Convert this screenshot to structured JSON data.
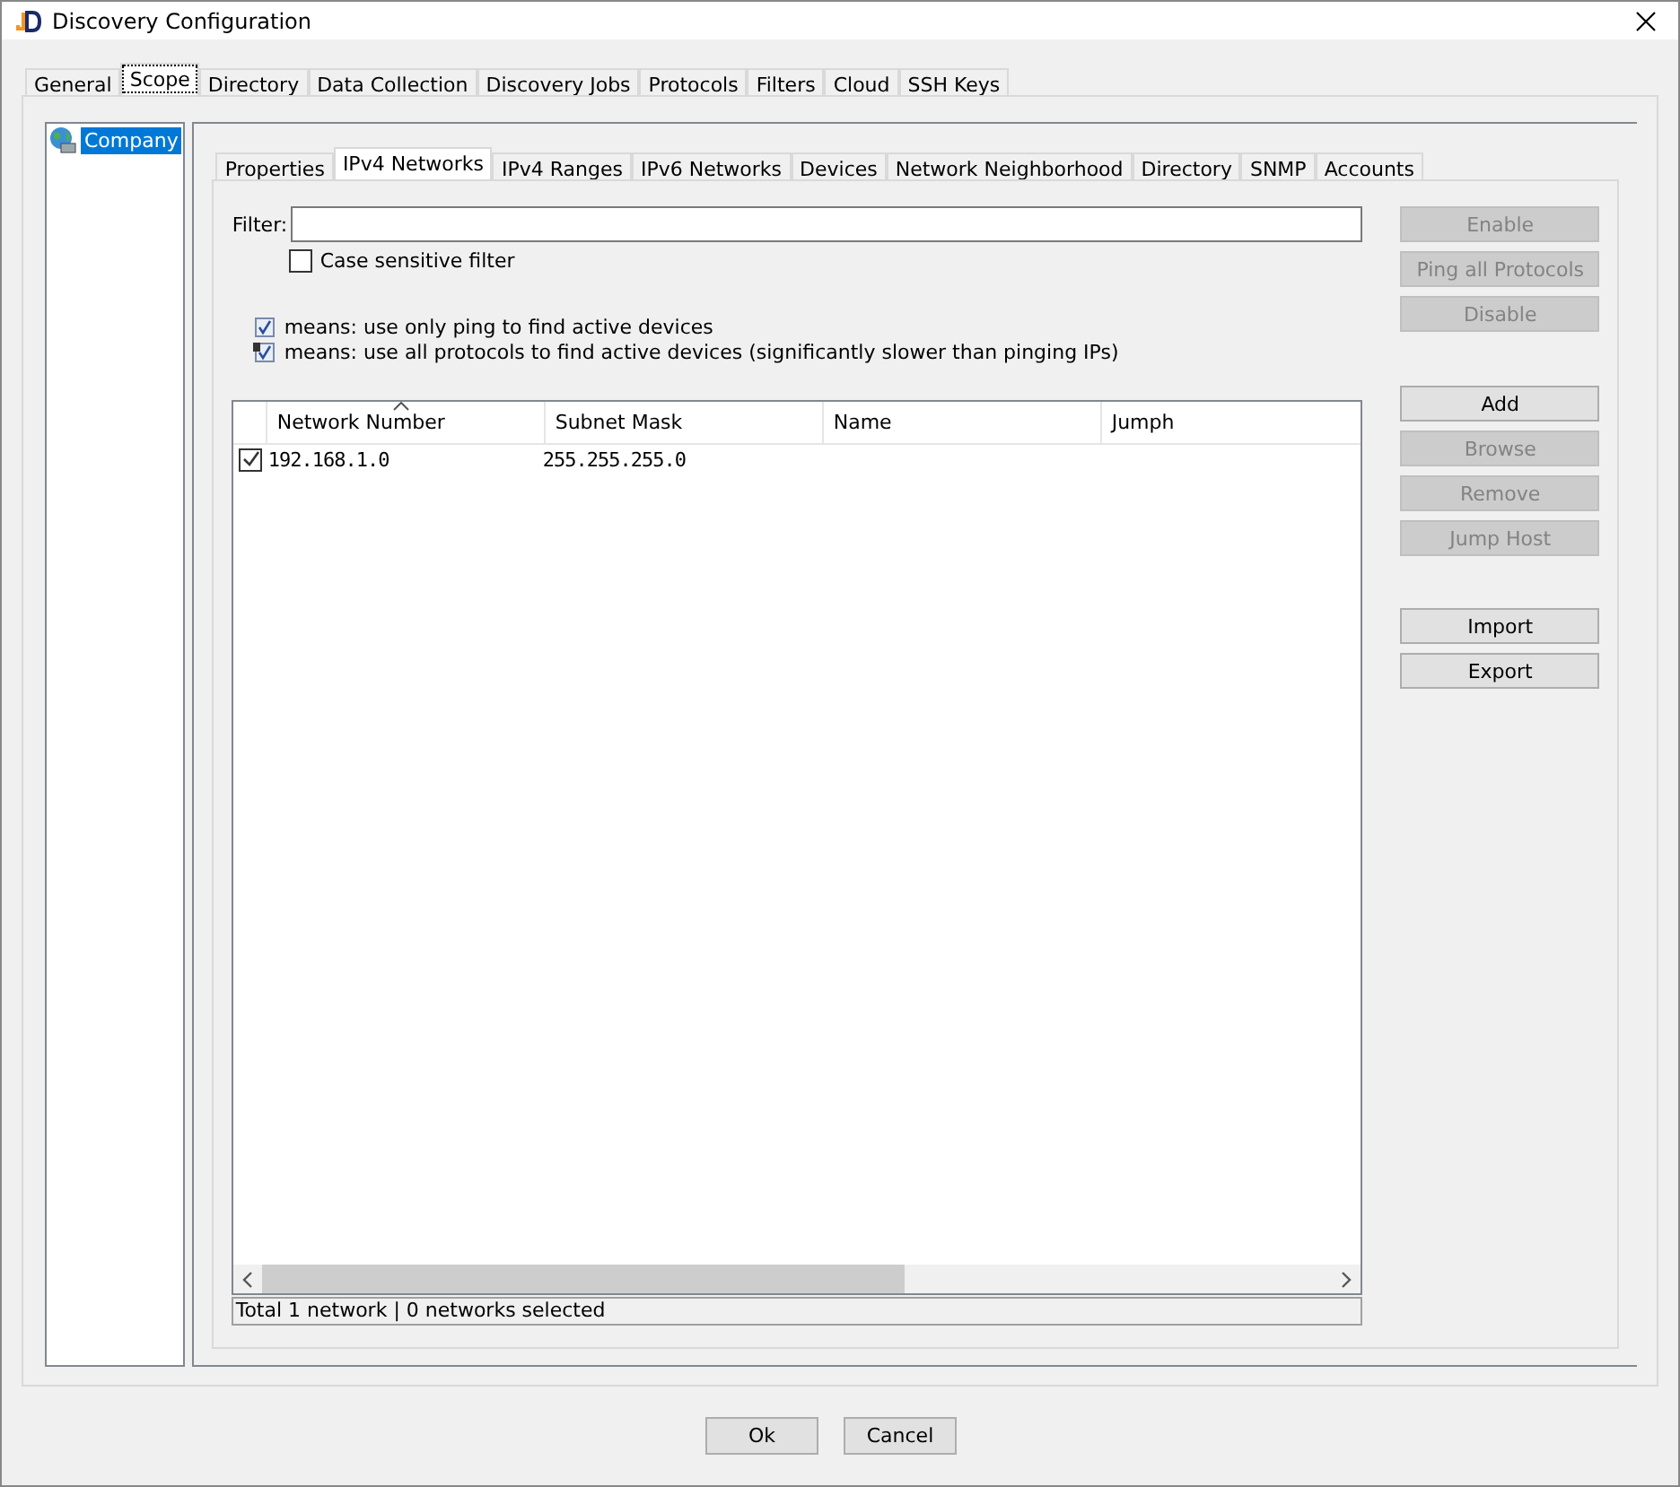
{
  "window": {
    "title": "Discovery Configuration"
  },
  "tabs": [
    {
      "label": "General",
      "selected": false
    },
    {
      "label": "Scope",
      "selected": true
    },
    {
      "label": "Directory",
      "selected": false
    },
    {
      "label": "Data Collection",
      "selected": false
    },
    {
      "label": "Discovery Jobs",
      "selected": false
    },
    {
      "label": "Protocols",
      "selected": false
    },
    {
      "label": "Filters",
      "selected": false
    },
    {
      "label": "Cloud",
      "selected": false
    },
    {
      "label": "SSH Keys",
      "selected": false
    }
  ],
  "tree": {
    "items": [
      {
        "label": "Company",
        "selected": true
      }
    ]
  },
  "subtabs": [
    {
      "label": "Properties",
      "selected": false
    },
    {
      "label": "IPv4 Networks",
      "selected": true
    },
    {
      "label": "IPv4 Ranges",
      "selected": false
    },
    {
      "label": "IPv6 Networks",
      "selected": false
    },
    {
      "label": "Devices",
      "selected": false
    },
    {
      "label": "Network Neighborhood",
      "selected": false
    },
    {
      "label": "Directory",
      "selected": false
    },
    {
      "label": "SNMP",
      "selected": false
    },
    {
      "label": "Accounts",
      "selected": false
    }
  ],
  "filter": {
    "label": "Filter:"
  },
  "case_sensitive": {
    "label": "Case sensitive filter",
    "checked": false
  },
  "legend": [
    {
      "kind": "ping",
      "text": "means: use only ping to find active devices"
    },
    {
      "kind": "all",
      "text": "means: use all protocols to find active devices (significantly slower than pinging IPs)"
    }
  ],
  "table": {
    "columns": [
      {
        "label": "Network Number",
        "sorted": true
      },
      {
        "label": "Subnet Mask",
        "sorted": false
      },
      {
        "label": "Name",
        "sorted": false
      },
      {
        "label": "Jumph",
        "sorted": false
      }
    ],
    "rows": [
      {
        "checked": true,
        "cells": [
          "192.168.1.0",
          "255.255.255.0",
          "",
          ""
        ]
      }
    ]
  },
  "status_bar": "Total 1 network | 0 networks selected",
  "side_button_groups": [
    [
      {
        "label": "Enable",
        "disabled": true
      },
      {
        "label": "Ping all Protocols",
        "disabled": true
      },
      {
        "label": "Disable",
        "disabled": true
      }
    ],
    [
      {
        "label": "Add",
        "disabled": false
      },
      {
        "label": "Browse",
        "disabled": true
      },
      {
        "label": "Remove",
        "disabled": true
      },
      {
        "label": "Jump Host",
        "disabled": true
      }
    ],
    [
      {
        "label": "Import",
        "disabled": false
      },
      {
        "label": "Export",
        "disabled": false
      }
    ]
  ],
  "buttons": [
    "Ok",
    "Cancel"
  ]
}
